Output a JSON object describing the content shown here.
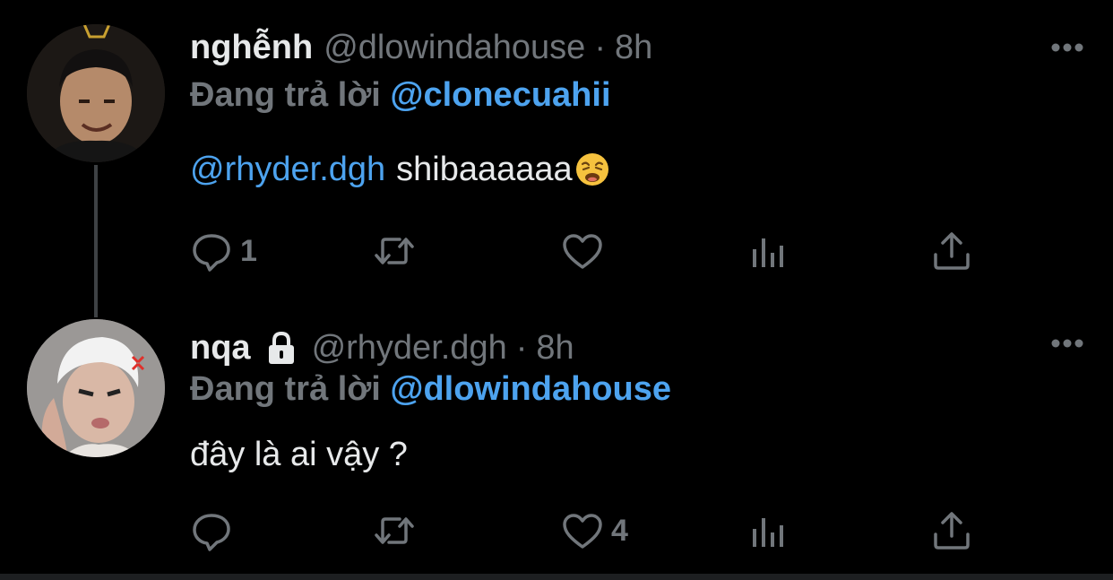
{
  "tweets": [
    {
      "display_name": "nghễnh",
      "handle": "@dlowindahouse",
      "dot": "·",
      "time": "8h",
      "reply_prefix": "Đang trả lời",
      "reply_target": "@clonecuahii",
      "mention": "@rhyder.dgh",
      "text": "shibaaaaaa",
      "emoji": "weary-face-emoji",
      "reply_count": "1",
      "retweet_count": "",
      "like_count": "",
      "avatar": "user-photo-avatar"
    },
    {
      "display_name": "nqa",
      "protected": true,
      "handle": "@rhyder.dgh",
      "dot": "·",
      "time": "8h",
      "reply_prefix": "Đang trả lời",
      "reply_target": "@dlowindahouse",
      "mention": "",
      "text": "đây là ai vậy ?",
      "reply_count": "",
      "retweet_count": "",
      "like_count": "4",
      "avatar": "user-photo-avatar"
    }
  ],
  "icons": {
    "reply": "reply-icon",
    "retweet": "retweet-icon",
    "like": "heart-icon",
    "views": "views-icon",
    "share": "share-icon",
    "more": "more-icon",
    "lock": "lock-icon"
  },
  "colors": {
    "background": "#000000",
    "text": "#e7e9ea",
    "muted": "#71767b",
    "link": "#4da3ef",
    "thread_line": "#3e4144"
  }
}
